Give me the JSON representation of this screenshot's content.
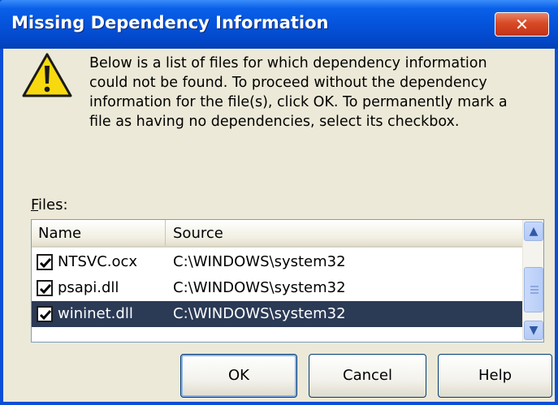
{
  "window": {
    "title": "Missing Dependency Information",
    "close_glyph": "✕"
  },
  "icon": {
    "name": "warning-icon"
  },
  "message": "Below is a list of files for which dependency information\ncould not be found. To proceed without the dependency\ninformation for the file(s), click OK. To permanently mark a\nfile as having no dependencies, select its checkbox.",
  "files_label": {
    "accel": "F",
    "rest": "iles:"
  },
  "table": {
    "columns": [
      "Name",
      "Source"
    ],
    "rows": [
      {
        "name": "NTSVC.ocx",
        "source": "C:\\WINDOWS\\system32",
        "checked": true,
        "selected": false
      },
      {
        "name": "psapi.dll",
        "source": "C:\\WINDOWS\\system32",
        "checked": true,
        "selected": false
      },
      {
        "name": "wininet.dll",
        "source": "C:\\WINDOWS\\system32",
        "checked": true,
        "selected": true
      }
    ]
  },
  "buttons": {
    "ok": "OK",
    "cancel": "Cancel",
    "help": "Help"
  },
  "colors": {
    "titlebar": "#0553db",
    "dialog_bg": "#ece9d8",
    "selection_inactive": "#2b3a55",
    "close_button": "#d84a24"
  }
}
